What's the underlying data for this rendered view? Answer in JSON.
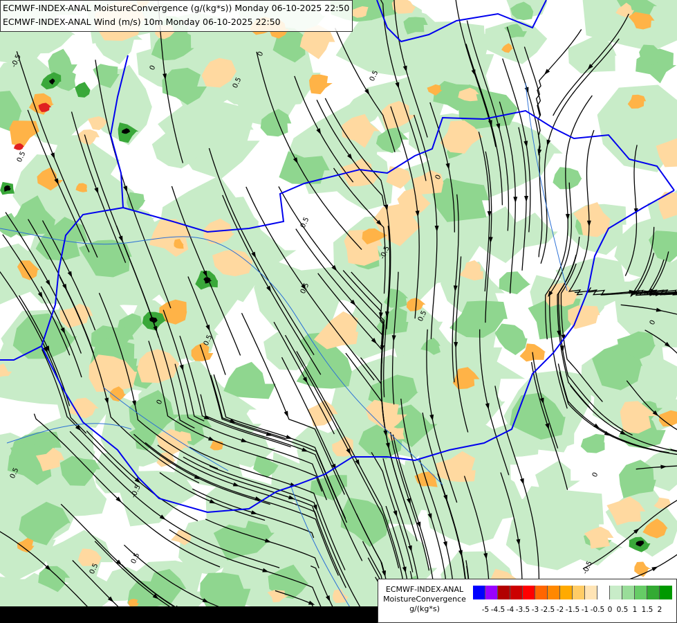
{
  "header": {
    "line1": "ECMWF-INDEX-ANAL MoistureConvergence (g/(kg*s)) Monday 06-10-2025 22:50",
    "line2": "ECMWF-INDEX-ANAL Wind (m/s) 10m Monday 06-10-2025 22:50"
  },
  "legend": {
    "title_line1": "ECMWF-INDEX-ANAL",
    "title_line2": "MoistureConvergence",
    "title_line3": "g/(kg*s)",
    "colors": [
      "#0000ff",
      "#9900ff",
      "#b20000",
      "#cc0000",
      "#ff0000",
      "#ff6600",
      "#ff8800",
      "#ffaa00",
      "#ffcc66",
      "#ffe4b5",
      "#ffffff",
      "#c8ecc8",
      "#99dd99",
      "#66cc66",
      "#33aa33",
      "#009900"
    ],
    "tick_labels": [
      "-5",
      "-4.5",
      "-4",
      "-3.5",
      "-3",
      "-2.5",
      "-2",
      "-1.5",
      "-1",
      "-0.5",
      "0",
      "0.5",
      "1",
      "1.5",
      "2"
    ]
  },
  "contour_labels": [
    "0",
    "0.5",
    "-0.5",
    "0",
    "0.5",
    "0",
    "0.5",
    "-0.5",
    "0.5",
    "0.5",
    "0.5",
    "0",
    "-0.5",
    "0.5",
    "0",
    "0.5",
    "0.5",
    "-0.5",
    "0",
    "0.5"
  ],
  "colors": {
    "border": "#0000ee",
    "river": "#2a6fd6",
    "streamline": "#000000",
    "green_light": "#c8ecc8",
    "green_mid": "#8fd68f",
    "green_dark": "#3aa83a",
    "orange_light": "#ffd9a0",
    "orange_mid": "#ffb347",
    "red": "#e02020"
  }
}
